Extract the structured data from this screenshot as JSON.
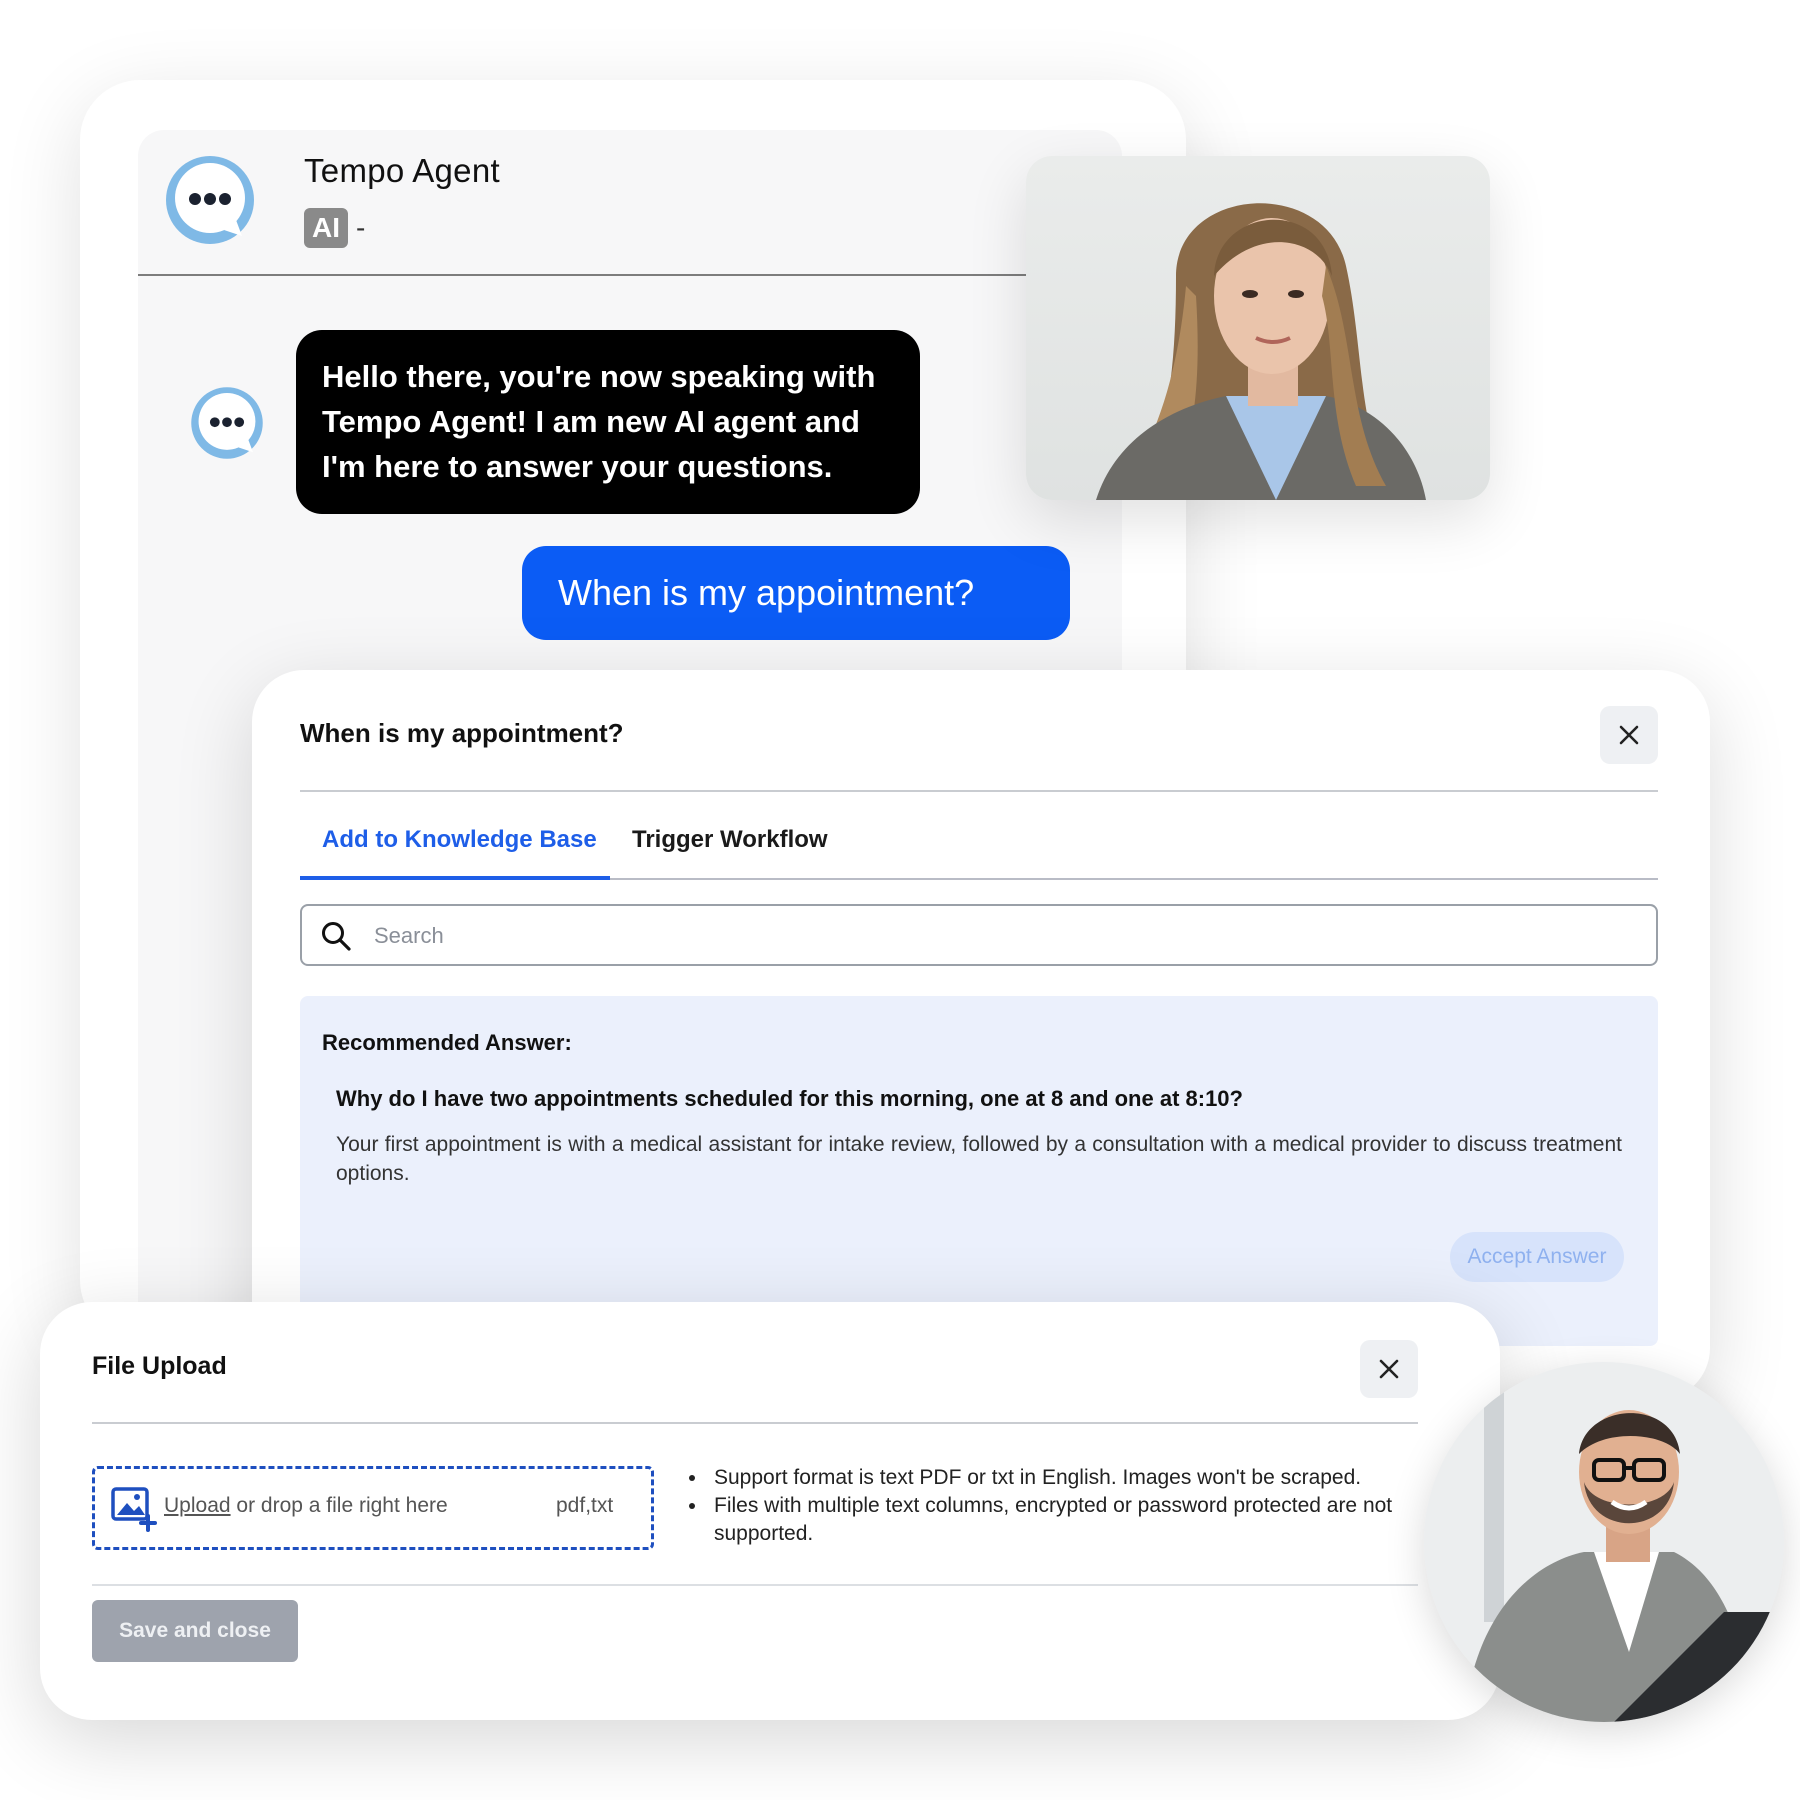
{
  "chat": {
    "agent_name": "Tempo Agent",
    "badge": "AI",
    "status": "-",
    "messages": {
      "agent": "Hello there, you're now speaking with Tempo Agent! I am new AI agent and I'm here to answer your questions.",
      "user": "When is my appointment?"
    }
  },
  "kb_modal": {
    "title": "When is my appointment?",
    "tabs": [
      "Add to Knowledge Base",
      "Trigger Workflow"
    ],
    "active_tab": "Add to Knowledge Base",
    "search_placeholder": "Search",
    "recommended_label": "Recommended Answer:",
    "question": "Why do I have two appointments scheduled for this morning, one at 8 and one at 8:10?",
    "answer": "Your first appointment is with a medical assistant for intake review, followed by a consultation with a medical provider to discuss treatment options.",
    "accept_label": "Accept Answer"
  },
  "file_upload": {
    "title": "File Upload",
    "upload_link": "Upload",
    "drop_text": " or drop a file right here",
    "formats": "pdf,txt",
    "notes": [
      "Support format is text PDF or txt in English. Images won't be scraped.",
      "Files with multiple text columns, encrypted or password protected are not supported."
    ],
    "save_label": "Save and close"
  },
  "colors": {
    "accent_blue": "#0b5cf5",
    "tab_blue": "#1e5ee8",
    "agent_avatar": "#7fb9e6",
    "answer_panel": "#ebf0fc"
  },
  "icons": [
    "chat-dots-icon",
    "close-icon",
    "search-icon",
    "image-upload-icon"
  ]
}
